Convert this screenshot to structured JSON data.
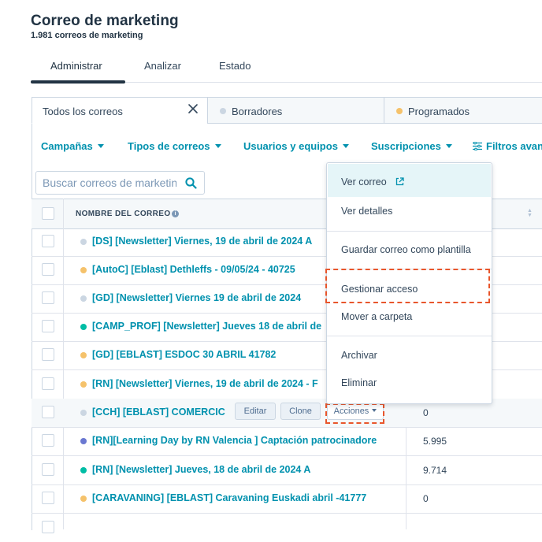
{
  "page": {
    "title": "Correo de marketing",
    "subtitle": "1.981 correos de marketing"
  },
  "tabs": [
    "Administrar",
    "Analizar",
    "Estado"
  ],
  "view_tabs": [
    {
      "label": "Todos los correos"
    },
    {
      "label": "Borradores",
      "dot_color": "#cbd6e2"
    },
    {
      "label": "Programados",
      "dot_color": "#f5c26b"
    }
  ],
  "filters": [
    "Campañas",
    "Tipos de correos",
    "Usuarios y equipos",
    "Suscripciones",
    "Filtros avan"
  ],
  "search": {
    "placeholder": "Buscar correos de marketing",
    "value": ""
  },
  "table": {
    "header_name": "NOMBRE DEL CORREO",
    "rows": [
      {
        "name": "[DS] [Newsletter] Viernes, 19 de abril de 2024 A",
        "status_color": "#cbd6e2",
        "value": ""
      },
      {
        "name": "[AutoC] [Eblast] Dethleffs - 09/05/24 - 40725",
        "status_color": "#f5c26b",
        "value": ""
      },
      {
        "name": "[GD] [Newsletter] Viernes 19 de abril de 2024",
        "status_color": "#cbd6e2",
        "value": ""
      },
      {
        "name": "[CAMP_PROF] [Newsletter] Jueves 18 de abril de",
        "status_color": "#00bda5",
        "value": ""
      },
      {
        "name": "[GD] [EBLAST] ESDOC 30 ABRIL 41782",
        "status_color": "#f5c26b",
        "value": ""
      },
      {
        "name": "[RN] [Newsletter] Viernes, 19 de abril de 2024 - F",
        "status_color": "#f5c26b",
        "value": ""
      },
      {
        "name": "[CCH] [EBLAST] COMERCIC",
        "status_color": "#cbd6e2",
        "value": "0"
      },
      {
        "name": "[RN][Learning Day by RN Valencia ] Captación patrocinadore",
        "status_color": "#6a78d1",
        "value": "5.995"
      },
      {
        "name": "[RN] [Newsletter] Jueves, 18 de abril de 2024 A",
        "status_color": "#00bda5",
        "value": "9.714"
      },
      {
        "name": "[CARAVANING] [EBLAST] Caravaning Euskadi abril -41777",
        "status_color": "#f5c26b",
        "value": "0"
      }
    ],
    "hover_buttons": {
      "edit": "Editar",
      "clone": "Clone",
      "actions": "Acciones"
    }
  },
  "actions_menu": {
    "items": [
      "Ver correo",
      "Ver detalles",
      "Guardar correo como plantilla",
      "Gestionar acceso",
      "Mover a carpeta",
      "Archivar",
      "Eliminar"
    ]
  },
  "colors": {
    "accent": "#0091ae",
    "highlight": "#e8562c",
    "text": "#33475b"
  },
  "icons": {
    "close": "close-icon",
    "search": "search-icon",
    "filter": "filter-icon",
    "external": "external-link-icon",
    "info": "info-icon",
    "sort": "sort-icon"
  }
}
